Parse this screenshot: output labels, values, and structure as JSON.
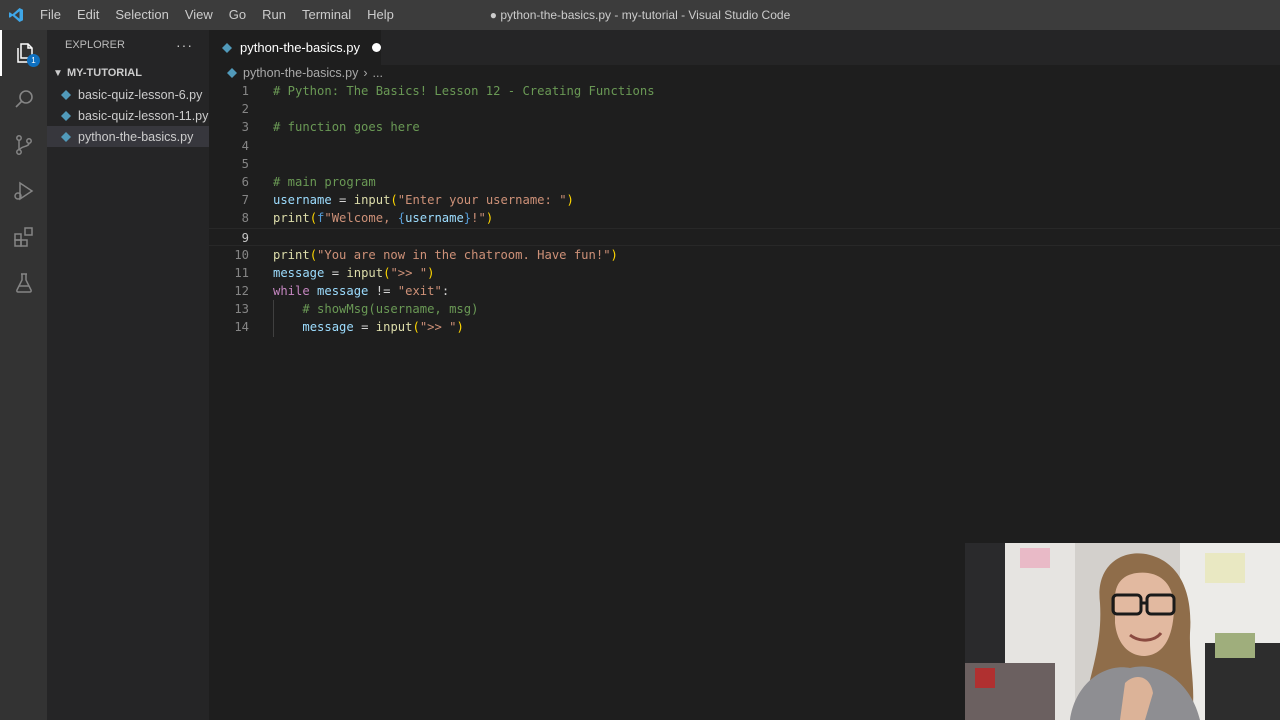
{
  "titlebar": {
    "menu": [
      "File",
      "Edit",
      "Selection",
      "View",
      "Go",
      "Run",
      "Terminal",
      "Help"
    ],
    "window_title": "● python-the-basics.py - my-tutorial - Visual Studio Code"
  },
  "activity": {
    "icons": [
      "files-icon",
      "search-icon",
      "source-control-icon",
      "run-debug-icon",
      "extensions-icon",
      "testing-icon"
    ],
    "explorer_badge": "1"
  },
  "sidebar": {
    "header": "EXPLORER",
    "more": "···",
    "folder": "MY-TUTORIAL",
    "files": [
      {
        "name": "basic-quiz-lesson-6.py"
      },
      {
        "name": "basic-quiz-lesson-11.py"
      },
      {
        "name": "python-the-basics.py"
      }
    ]
  },
  "editor": {
    "tab_label": "python-the-basics.py",
    "breadcrumb_file": "python-the-basics.py",
    "breadcrumb_sep": "›",
    "breadcrumb_more": "...",
    "line_numbers": [
      "1",
      "2",
      "3",
      "4",
      "5",
      "6",
      "7",
      "8",
      "9",
      "10",
      "11",
      "12",
      "13",
      "14"
    ],
    "lines": [
      "# Python: The Basics! Lesson 12 - Creating Functions",
      "",
      "# function goes here",
      "",
      "",
      "# main program",
      "username = input(\"Enter your username: \")",
      "print(f\"Welcome, {username}!\")",
      "",
      "print(\"You are now in the chatroom. Have fun!\")",
      "message = input(\">> \")",
      "while message != \"exit\":",
      "    # showMsg(username, msg)",
      "    message = input(\">> \")"
    ]
  },
  "colors": {
    "comment": "#6a9955",
    "variable": "#9cdcfe",
    "function": "#dcdcaa",
    "string": "#ce9178",
    "keyword": "#c586c0",
    "accent": "#0e70c0"
  }
}
